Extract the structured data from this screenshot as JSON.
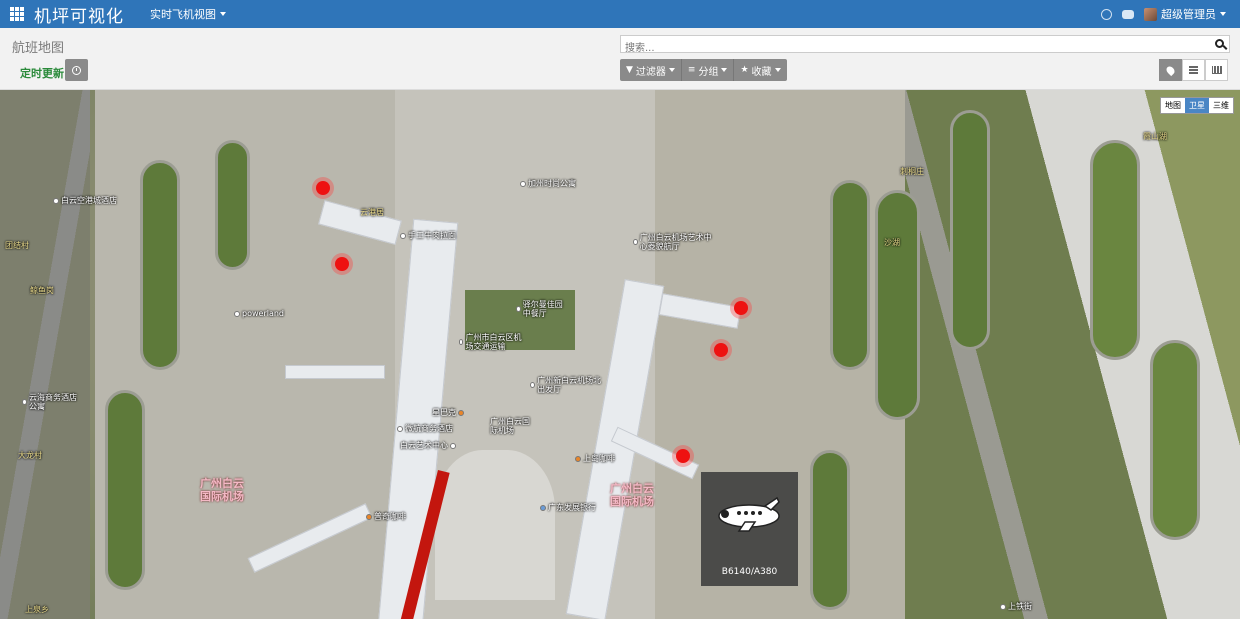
{
  "header": {
    "brand": "机坪可视化",
    "menu_label": "实时飞机视图",
    "user_name": "超级管理员"
  },
  "subheader": {
    "page_title": "航班地图",
    "search_placeholder": "搜索...",
    "auto_refresh_label": "定时更新",
    "filter_label": "过滤器",
    "group_label": "分组",
    "favorites_label": "收藏"
  },
  "map": {
    "type_buttons": [
      "地图",
      "卫星",
      "三维"
    ],
    "active_type": "卫星",
    "pois": [
      {
        "label": "白云空港城酒店"
      },
      {
        "label": "powerland"
      },
      {
        "label": "云海商务酒店公寓"
      },
      {
        "label": "加州时尚公寓"
      },
      {
        "label": "手工牛肉拉面"
      },
      {
        "label": "广州白云机场艺术中心菱貌航厅"
      },
      {
        "label": "驿尔曼佳园中餐厅"
      },
      {
        "label": "广州市白云区机场交通运输"
      },
      {
        "label": "广州新白云机场北出发厅"
      },
      {
        "label": "星巴克"
      },
      {
        "label": "微航商务酒店"
      },
      {
        "label": "白云艺术中心"
      },
      {
        "label": "广州白云国际机场"
      },
      {
        "label": "上岛咖啡"
      },
      {
        "label": "广东发展银行"
      },
      {
        "label": "普奇咖啡"
      },
      {
        "label": "云港居"
      },
      {
        "label": "鲸鱼岗"
      },
      {
        "label": "大龙村"
      },
      {
        "label": "团结村"
      },
      {
        "label": "刺桐庄"
      },
      {
        "label": "上泉乡"
      },
      {
        "label": "霞山湖"
      },
      {
        "label": "沙湖"
      },
      {
        "label": "上铁街"
      }
    ],
    "airport_labels": [
      {
        "line1": "广州白云",
        "line2": "国际机场"
      },
      {
        "line1": "广州白云",
        "line2": "国际机场"
      }
    ],
    "popup": {
      "label": "B6140/A380"
    }
  }
}
